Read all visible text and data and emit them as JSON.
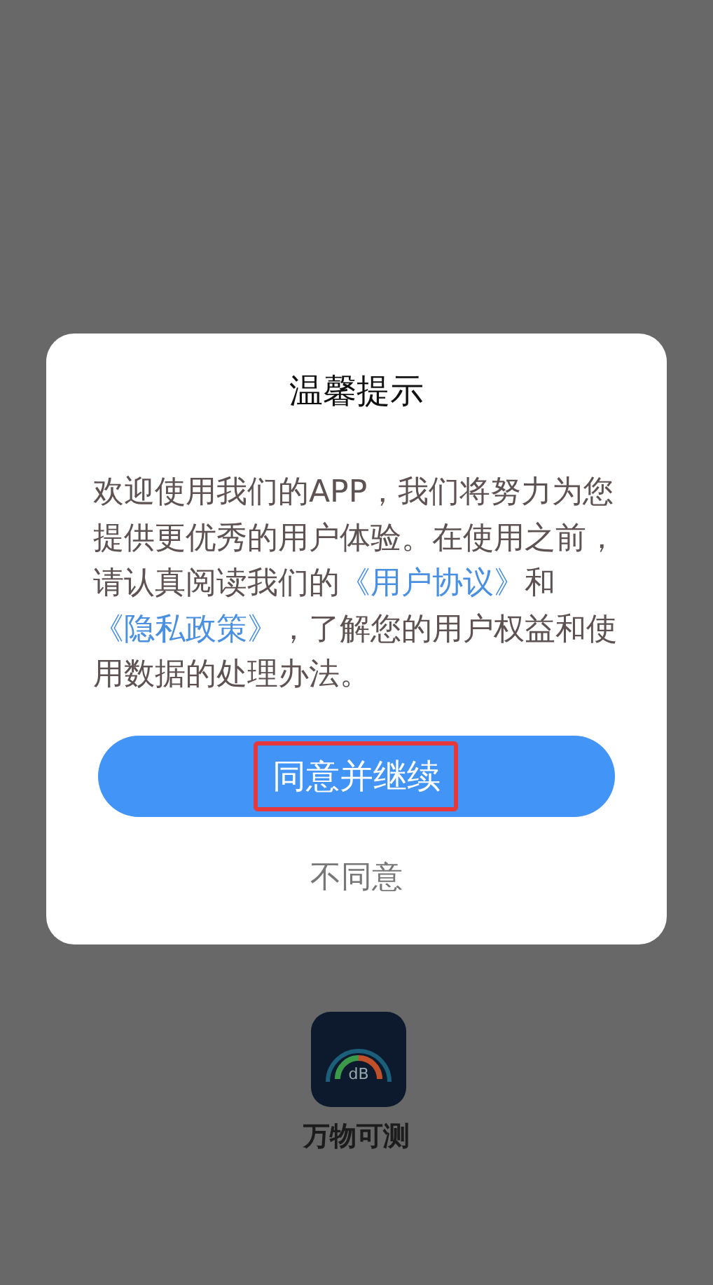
{
  "background": {
    "app_icon_text": "dB",
    "app_name": "万物可测"
  },
  "dialog": {
    "title": "温馨提示",
    "message": [
      {
        "kind": "plain",
        "text": "欢迎使用我们的APP，我们将努力为您提供更优秀的用户体验。在使用之前，请认真阅读我们的"
      },
      {
        "kind": "link",
        "text": "《用户协议》"
      },
      {
        "kind": "plain",
        "text": "和"
      },
      {
        "kind": "link",
        "text": "《隐私政策》"
      },
      {
        "kind": "plain",
        "text": "，了解您的用户权益和使用数据的处理办法。"
      }
    ],
    "primary_button": {
      "label": "同意并继续",
      "highlighted": true
    },
    "secondary_button": {
      "label": "不同意"
    }
  }
}
